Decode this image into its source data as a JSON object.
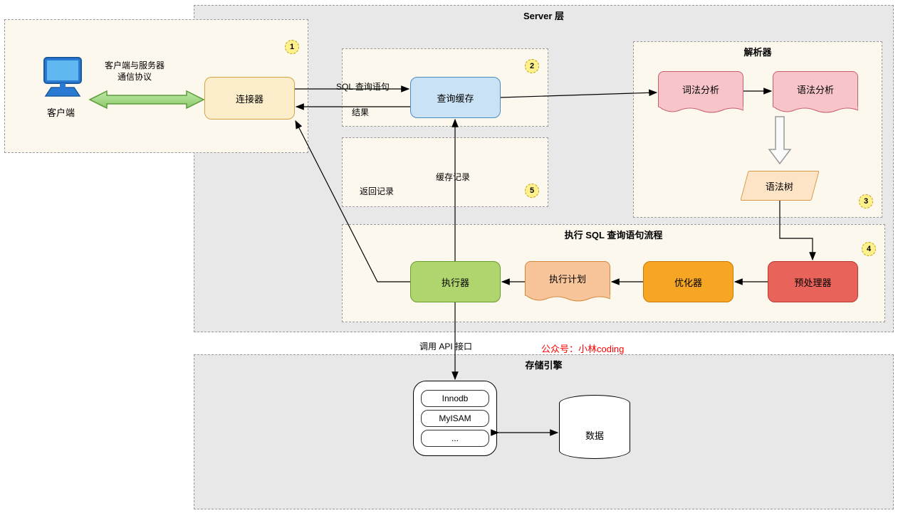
{
  "layers": {
    "server": "Server 层",
    "storage": "存储引擎"
  },
  "groups": {
    "parser": "解析器",
    "exec_flow": "执行 SQL 查询语句流程"
  },
  "nodes": {
    "client": "客户端",
    "connector": "连接器",
    "query_cache": "查询缓存",
    "lexical": "词法分析",
    "syntax": "语法分析",
    "syntax_tree": "语法树",
    "preprocessor": "预处理器",
    "optimizer": "优化器",
    "exec_plan": "执行计划",
    "executor": "执行器",
    "innodb": "Innodb",
    "myisam": "MyISAM",
    "etc": "...",
    "data": "数据"
  },
  "labels": {
    "protocol1": "客户端与服务器",
    "protocol2": "通信协议",
    "sql_query": "SQL 查询语句",
    "result": "结果",
    "cache_record": "缓存记录",
    "return_record": "返回记录",
    "api_call": "调用 API 接口",
    "credit": "公众号：小林coding"
  },
  "badges": {
    "b1": "1",
    "b2": "2",
    "b3": "3",
    "b4": "4",
    "b5": "5"
  }
}
